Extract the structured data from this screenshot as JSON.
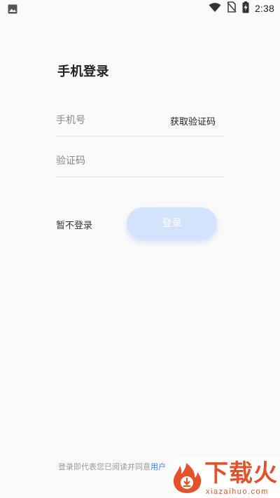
{
  "status_bar": {
    "time": "2:38",
    "icons": [
      "image-icon",
      "wifi-icon",
      "no-sim-icon",
      "battery-charging-icon"
    ]
  },
  "title": "手机登录",
  "phone_field": {
    "placeholder": "手机号",
    "value": ""
  },
  "get_code_label": "获取验证码",
  "code_field": {
    "placeholder": "验证码",
    "value": ""
  },
  "skip_label": "暂不登录",
  "login_label": "登录",
  "agreement": {
    "text": "登录即代表您已阅读并同意",
    "link": "用户"
  },
  "watermark": {
    "brand": "下载火",
    "domain": "xiazaihuo.com"
  },
  "colors": {
    "background": "#fafafa",
    "login_button": "#d4e3fc",
    "link": "#4a7ad8",
    "watermark": "#e2532d"
  }
}
